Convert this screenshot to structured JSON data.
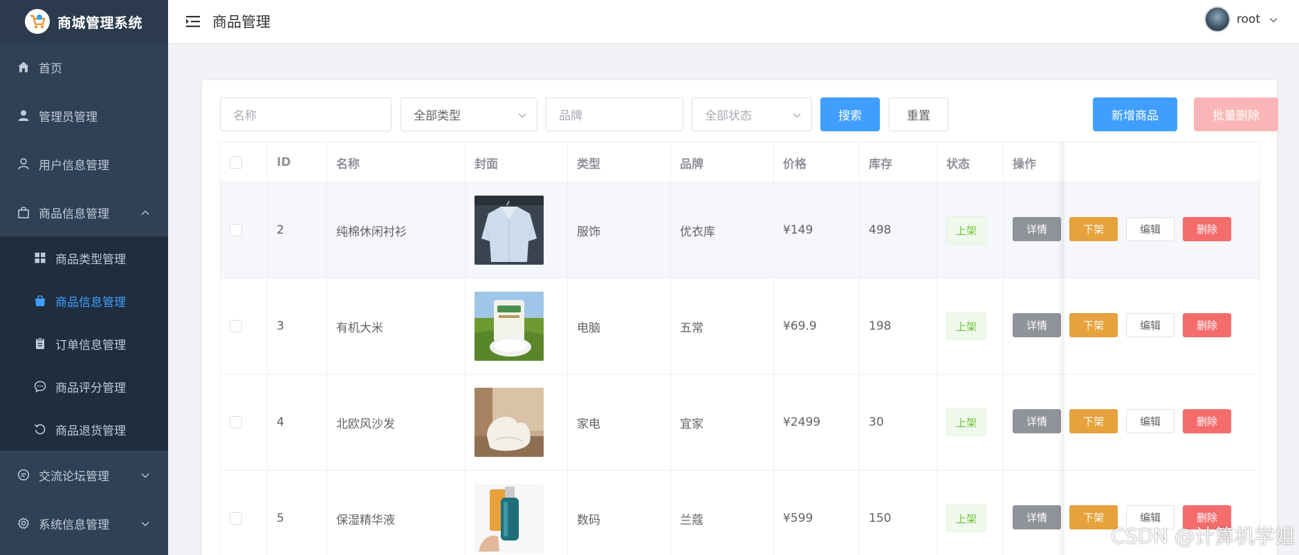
{
  "app": {
    "title": "商城管理系统"
  },
  "sidebar": {
    "items": [
      {
        "label": "首页",
        "icon": "home-icon"
      },
      {
        "label": "管理员管理",
        "icon": "user-filled-icon"
      },
      {
        "label": "用户信息管理",
        "icon": "user-icon"
      },
      {
        "label": "商品信息管理",
        "icon": "shopping-bag-icon",
        "expanded": true
      },
      {
        "label": "交流论坛管理",
        "icon": "chat-icon"
      },
      {
        "label": "系统信息管理",
        "icon": "gear-icon"
      }
    ],
    "subitems": [
      {
        "label": "商品类型管理",
        "icon": "grid-icon"
      },
      {
        "label": "商品信息管理",
        "icon": "bag-icon",
        "active": true
      },
      {
        "label": "订单信息管理",
        "icon": "clipboard-icon"
      },
      {
        "label": "商品评分管理",
        "icon": "comment-icon"
      },
      {
        "label": "商品退货管理",
        "icon": "refresh-icon"
      }
    ]
  },
  "header": {
    "breadcrumb": "商品管理",
    "username": "root"
  },
  "filters": {
    "name_placeholder": "名称",
    "type_value": "全部类型",
    "brand_placeholder": "品牌",
    "status_placeholder": "全部状态",
    "search_label": "搜索",
    "reset_label": "重置",
    "add_label": "新增商品",
    "batch_delete_label": "批量删除"
  },
  "table": {
    "columns": [
      "ID",
      "名称",
      "封面",
      "类型",
      "品牌",
      "价格",
      "库存",
      "状态",
      "操作"
    ],
    "actions": {
      "detail": "详情",
      "offshelf": "下架",
      "edit": "编辑",
      "delete": "删除"
    },
    "rows": [
      {
        "id": "2",
        "name": "纯棉休闲衬衫",
        "cover": "shirt",
        "type": "服饰",
        "brand": "优衣库",
        "price": "¥149",
        "stock": "498",
        "status": "上架"
      },
      {
        "id": "3",
        "name": "有机大米",
        "cover": "rice",
        "type": "电脑",
        "brand": "五常",
        "price": "¥69.9",
        "stock": "198",
        "status": "上架"
      },
      {
        "id": "4",
        "name": "北欧风沙发",
        "cover": "sofa",
        "type": "家电",
        "brand": "宜家",
        "price": "¥2499",
        "stock": "30",
        "status": "上架"
      },
      {
        "id": "5",
        "name": "保湿精华液",
        "cover": "serum",
        "type": "数码",
        "brand": "兰蔻",
        "price": "¥599",
        "stock": "150",
        "status": "上架"
      }
    ]
  },
  "watermark": "CSDN @计算机学姐",
  "colors": {
    "primary": "#409eff",
    "sidebar": "#304156",
    "warning": "#e6a23c",
    "danger": "#f56c6c",
    "success": "#67c23a"
  }
}
